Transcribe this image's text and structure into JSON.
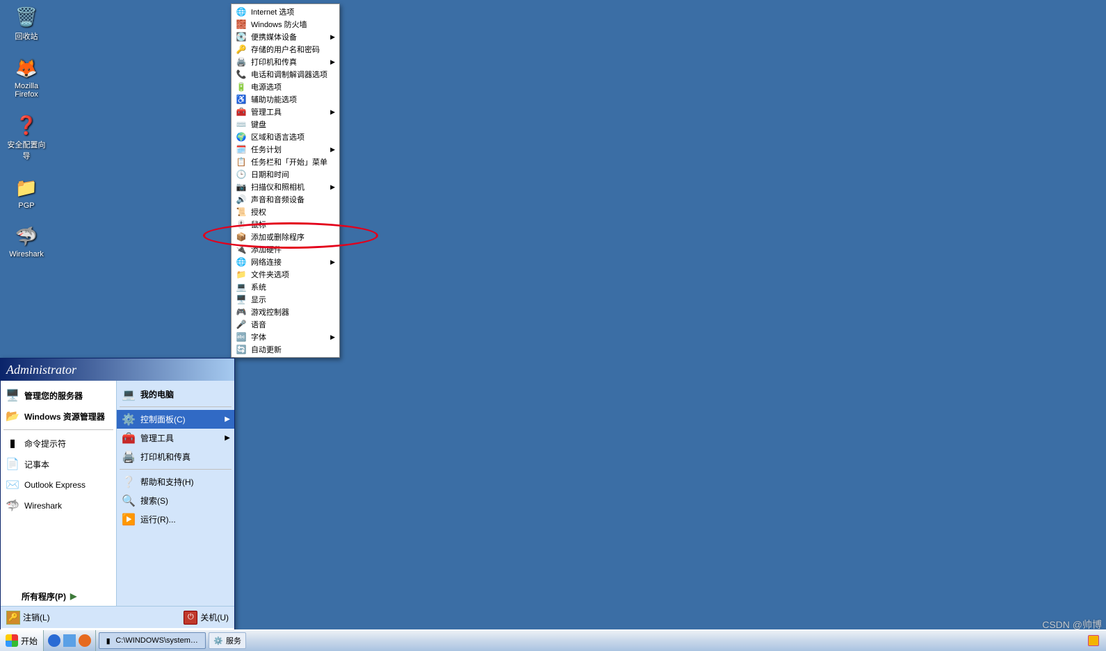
{
  "desktop_icons": [
    {
      "label": "回收站",
      "glyph": "🗑️"
    },
    {
      "label": "Mozilla Firefox",
      "glyph": "🦊"
    },
    {
      "label": "安全配置向导",
      "glyph": "❓"
    },
    {
      "label": "PGP",
      "glyph": "📁"
    },
    {
      "label": "Wireshark",
      "glyph": "🦈"
    }
  ],
  "start_menu": {
    "banner": "Administrator",
    "left": [
      {
        "label": "管理您的服务器",
        "icon": "🖥️",
        "bold": true
      },
      {
        "label": "Windows 资源管理器",
        "icon": "📂",
        "bold": true
      },
      {
        "label": "命令提示符",
        "icon": "▮"
      },
      {
        "label": "记事本",
        "icon": "📄"
      },
      {
        "label": "Outlook Express",
        "icon": "✉️"
      },
      {
        "label": "Wireshark",
        "icon": "🦈"
      }
    ],
    "right": [
      {
        "label": "我的电脑",
        "icon": "💻",
        "bold": true
      },
      {
        "label": "控制面板(C)",
        "icon": "⚙️",
        "submenu": true,
        "hover": true
      },
      {
        "label": "管理工具",
        "icon": "🧰",
        "submenu": true
      },
      {
        "label": "打印机和传真",
        "icon": "🖨️"
      },
      {
        "label": "帮助和支持(H)",
        "icon": "❔"
      },
      {
        "label": "搜索(S)",
        "icon": "🔍"
      },
      {
        "label": "运行(R)...",
        "icon": "▶️"
      }
    ],
    "all_programs": "所有程序(P)",
    "logoff": "注销(L)",
    "shutdown": "关机(U)"
  },
  "flyout": [
    {
      "label": "Internet 选项",
      "icon": "🌐"
    },
    {
      "label": "Windows 防火墙",
      "icon": "🧱"
    },
    {
      "label": "便携媒体设备",
      "icon": "💽",
      "submenu": true
    },
    {
      "label": "存储的用户名和密码",
      "icon": "🔑"
    },
    {
      "label": "打印机和传真",
      "icon": "🖨️",
      "submenu": true
    },
    {
      "label": "电话和调制解调器选项",
      "icon": "📞"
    },
    {
      "label": "电源选项",
      "icon": "🔋"
    },
    {
      "label": "辅助功能选项",
      "icon": "♿"
    },
    {
      "label": "管理工具",
      "icon": "🧰",
      "submenu": true
    },
    {
      "label": "键盘",
      "icon": "⌨️"
    },
    {
      "label": "区域和语言选项",
      "icon": "🌍"
    },
    {
      "label": "任务计划",
      "icon": "🗓️",
      "submenu": true
    },
    {
      "label": "任务栏和「开始」菜单",
      "icon": "📋"
    },
    {
      "label": "日期和时间",
      "icon": "🕒"
    },
    {
      "label": "扫描仪和照相机",
      "icon": "📷",
      "submenu": true
    },
    {
      "label": "声音和音频设备",
      "icon": "🔊"
    },
    {
      "label": "授权",
      "icon": "📜"
    },
    {
      "label": "鼠标",
      "icon": "🖱️"
    },
    {
      "label": "添加或删除程序",
      "icon": "📦"
    },
    {
      "label": "添加硬件",
      "icon": "🔌"
    },
    {
      "label": "网络连接",
      "icon": "🌐",
      "submenu": true
    },
    {
      "label": "文件夹选项",
      "icon": "📁"
    },
    {
      "label": "系统",
      "icon": "💻"
    },
    {
      "label": "显示",
      "icon": "🖥️"
    },
    {
      "label": "游戏控制器",
      "icon": "🎮"
    },
    {
      "label": "语音",
      "icon": "🎤"
    },
    {
      "label": "字体",
      "icon": "🔤",
      "submenu": true
    },
    {
      "label": "自动更新",
      "icon": "🔄"
    }
  ],
  "taskbar": {
    "start": "开始",
    "tasks": [
      {
        "label": "C:\\WINDOWS\\system32...",
        "icon": "▮",
        "active": true
      },
      {
        "label": "服务",
        "icon": "⚙️"
      }
    ]
  },
  "watermark": "CSDN @帅博"
}
